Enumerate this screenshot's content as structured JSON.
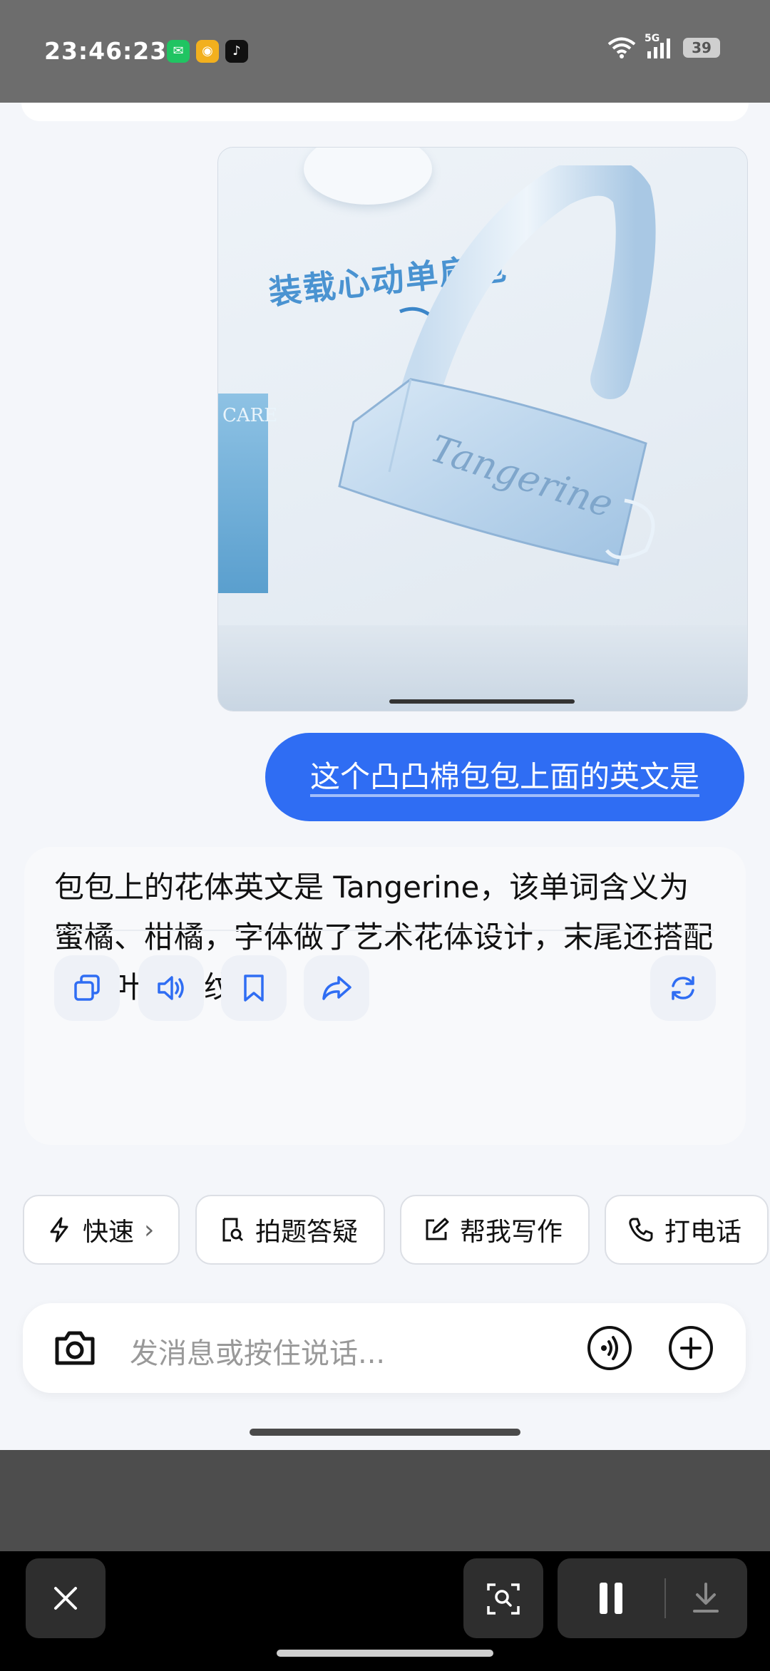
{
  "status_bar": {
    "time": "23:46:23",
    "notification_icons": [
      "wechat-icon",
      "weibo-icon",
      "tiktok-icon"
    ],
    "signal_label": "5G",
    "battery": "39"
  },
  "chat": {
    "image_caption": "装载心动单肩包",
    "image_side_text": "CARE",
    "user_message": "这个凸凸棉包包上面的英文是",
    "assistant_message": "包包上的花体英文是 Tangerine，该单词含义为蜜橘、柑橘，字体做了艺术花体设计，末尾还搭配了枝叶装饰纹样。",
    "actions": [
      "copy-icon",
      "speaker-icon",
      "bookmark-icon",
      "share-icon",
      "regenerate-icon"
    ]
  },
  "quick_chips": {
    "fast": "快速",
    "fast_suffix": "›",
    "photo_qa": "拍题答疑",
    "write": "帮我写作",
    "call": "打电话"
  },
  "composer": {
    "placeholder": "发消息或按住说话..."
  },
  "colors": {
    "accent": "#2f6df3",
    "chat_bg": "#f4f6fa",
    "status_bar": "#6d6d6d"
  }
}
